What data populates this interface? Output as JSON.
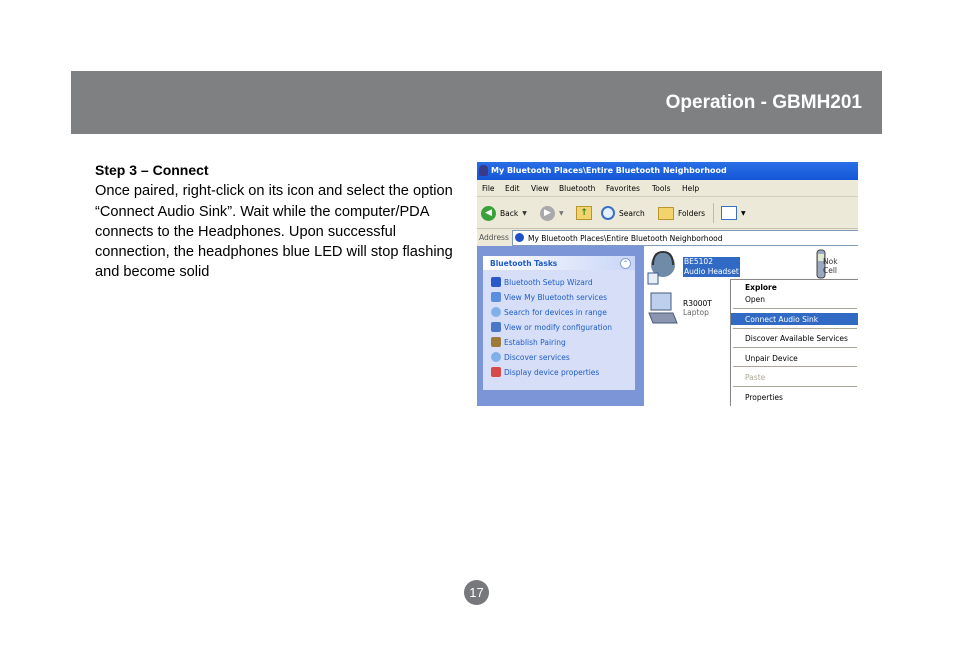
{
  "header": {
    "title": "Operation - GBMH201"
  },
  "body": {
    "heading": "Step 3 – Connect",
    "paragraph": "Once paired, right-click on its icon and select the option “Connect Audio Sink”.  Wait while the computer/PDA connects to the Headphones. Upon successful connection, the headphones blue LED will stop flashing and become solid"
  },
  "page_number": "17",
  "screenshot": {
    "window_title": "My Bluetooth Places\\Entire Bluetooth Neighborhood",
    "menu": [
      "File",
      "Edit",
      "View",
      "Bluetooth",
      "Favorites",
      "Tools",
      "Help"
    ],
    "toolbar": {
      "back": "Back",
      "search": "Search",
      "folders": "Folders"
    },
    "address": {
      "label": "Address",
      "value": "My Bluetooth Places\\Entire Bluetooth Neighborhood"
    },
    "tasks": {
      "title": "Bluetooth Tasks",
      "items": [
        "Bluetooth Setup Wizard",
        "View My Bluetooth services",
        "Search for devices in range",
        "View or modify configuration",
        "Establish Pairing",
        "Discover services",
        "Display device properties"
      ]
    },
    "devices": [
      {
        "name": "BE5102",
        "type": "Audio Headset"
      },
      {
        "name": "R3000T",
        "type": "Laptop"
      },
      {
        "name": "Nok",
        "type": "Cell"
      }
    ],
    "context_menu": {
      "items": [
        "Explore",
        "Open",
        "Connect Audio Sink",
        "Discover Available Services",
        "Unpair Device",
        "Paste",
        "Properties"
      ],
      "selected": "Connect Audio Sink"
    },
    "colors": {
      "titlebar": "#1456d6",
      "highlight": "#316ac5",
      "task_link": "#215dc6",
      "pane": "#7b95d6"
    }
  }
}
